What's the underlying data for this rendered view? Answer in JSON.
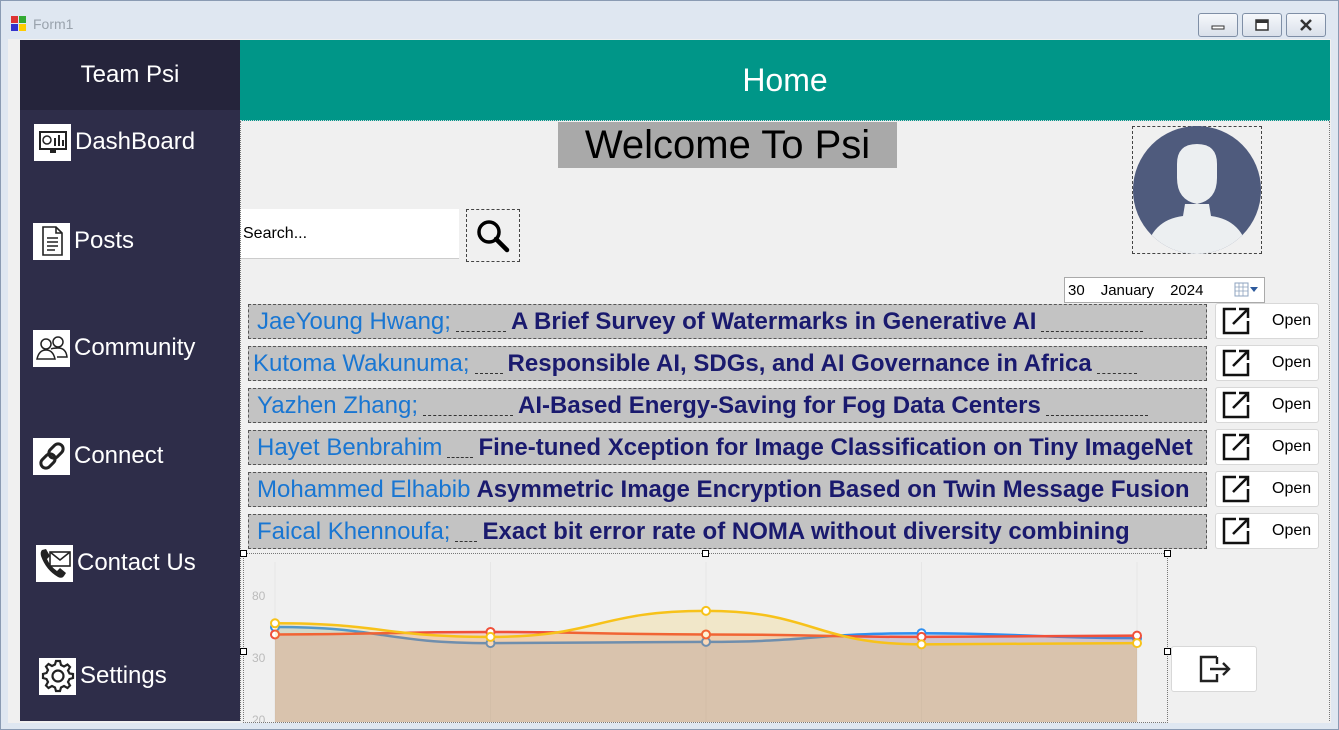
{
  "window": {
    "title": "Form1"
  },
  "sidebar": {
    "brand": "Team Psi",
    "items": [
      {
        "label": "DashBoard",
        "icon": "dashboard-icon"
      },
      {
        "label": "Posts",
        "icon": "document-icon"
      },
      {
        "label": "Community",
        "icon": "people-icon"
      },
      {
        "label": "Connect",
        "icon": "link-icon"
      },
      {
        "label": "Contact Us",
        "icon": "phone-mail-icon"
      },
      {
        "label": "Settings",
        "icon": "gear-icon"
      }
    ]
  },
  "header": {
    "title": "Home"
  },
  "main": {
    "welcome": "Welcome To Psi",
    "search": {
      "value": "Search..."
    },
    "date": {
      "day": "30",
      "month": "January",
      "year": "2024"
    },
    "open_label": "Open",
    "papers": [
      {
        "author": "JaeYoung Hwang;",
        "title": "A Brief Survey of Watermarks in Generative AI"
      },
      {
        "author": "Kutoma Wakunuma;",
        "title": "Responsible AI, SDGs, and AI Governance in Africa"
      },
      {
        "author": "Yazhen Zhang;",
        "title": "AI-Based Energy-Saving for Fog  Data Centers"
      },
      {
        "author": "Hayet Benbrahim",
        "title": "Fine-tuned Xception for Image Classification on Tiny ImageNet"
      },
      {
        "author": "Mohammed Elhabib",
        "title": "Asymmetric Image Encryption Based on Twin Message Fusion"
      },
      {
        "author": "Faical Khennoufa;",
        "title": "Exact bit error rate of  NOMA without diversity combining"
      }
    ]
  },
  "colors": {
    "sidebar": "#2e2d49",
    "brand_bg": "#25243b",
    "header": "#009688",
    "author": "#1976d2",
    "title": "#1a1a6e",
    "row_bg": "#c3c3c3"
  },
  "chart_data": {
    "type": "area",
    "title": "",
    "xlabel": "",
    "ylabel": "",
    "x": [
      0,
      1,
      2,
      3,
      4
    ],
    "y_ticks": [
      20,
      30,
      80
    ],
    "series": [
      {
        "values": [
          55,
          42,
          43,
          50,
          46
        ],
        "color": "#2f8ff0"
      },
      {
        "values": [
          49,
          51,
          49,
          47,
          48
        ],
        "color": "#f0503a"
      },
      {
        "values": [
          58,
          47,
          68,
          41,
          42
        ],
        "color": "#f7c21a"
      }
    ]
  }
}
